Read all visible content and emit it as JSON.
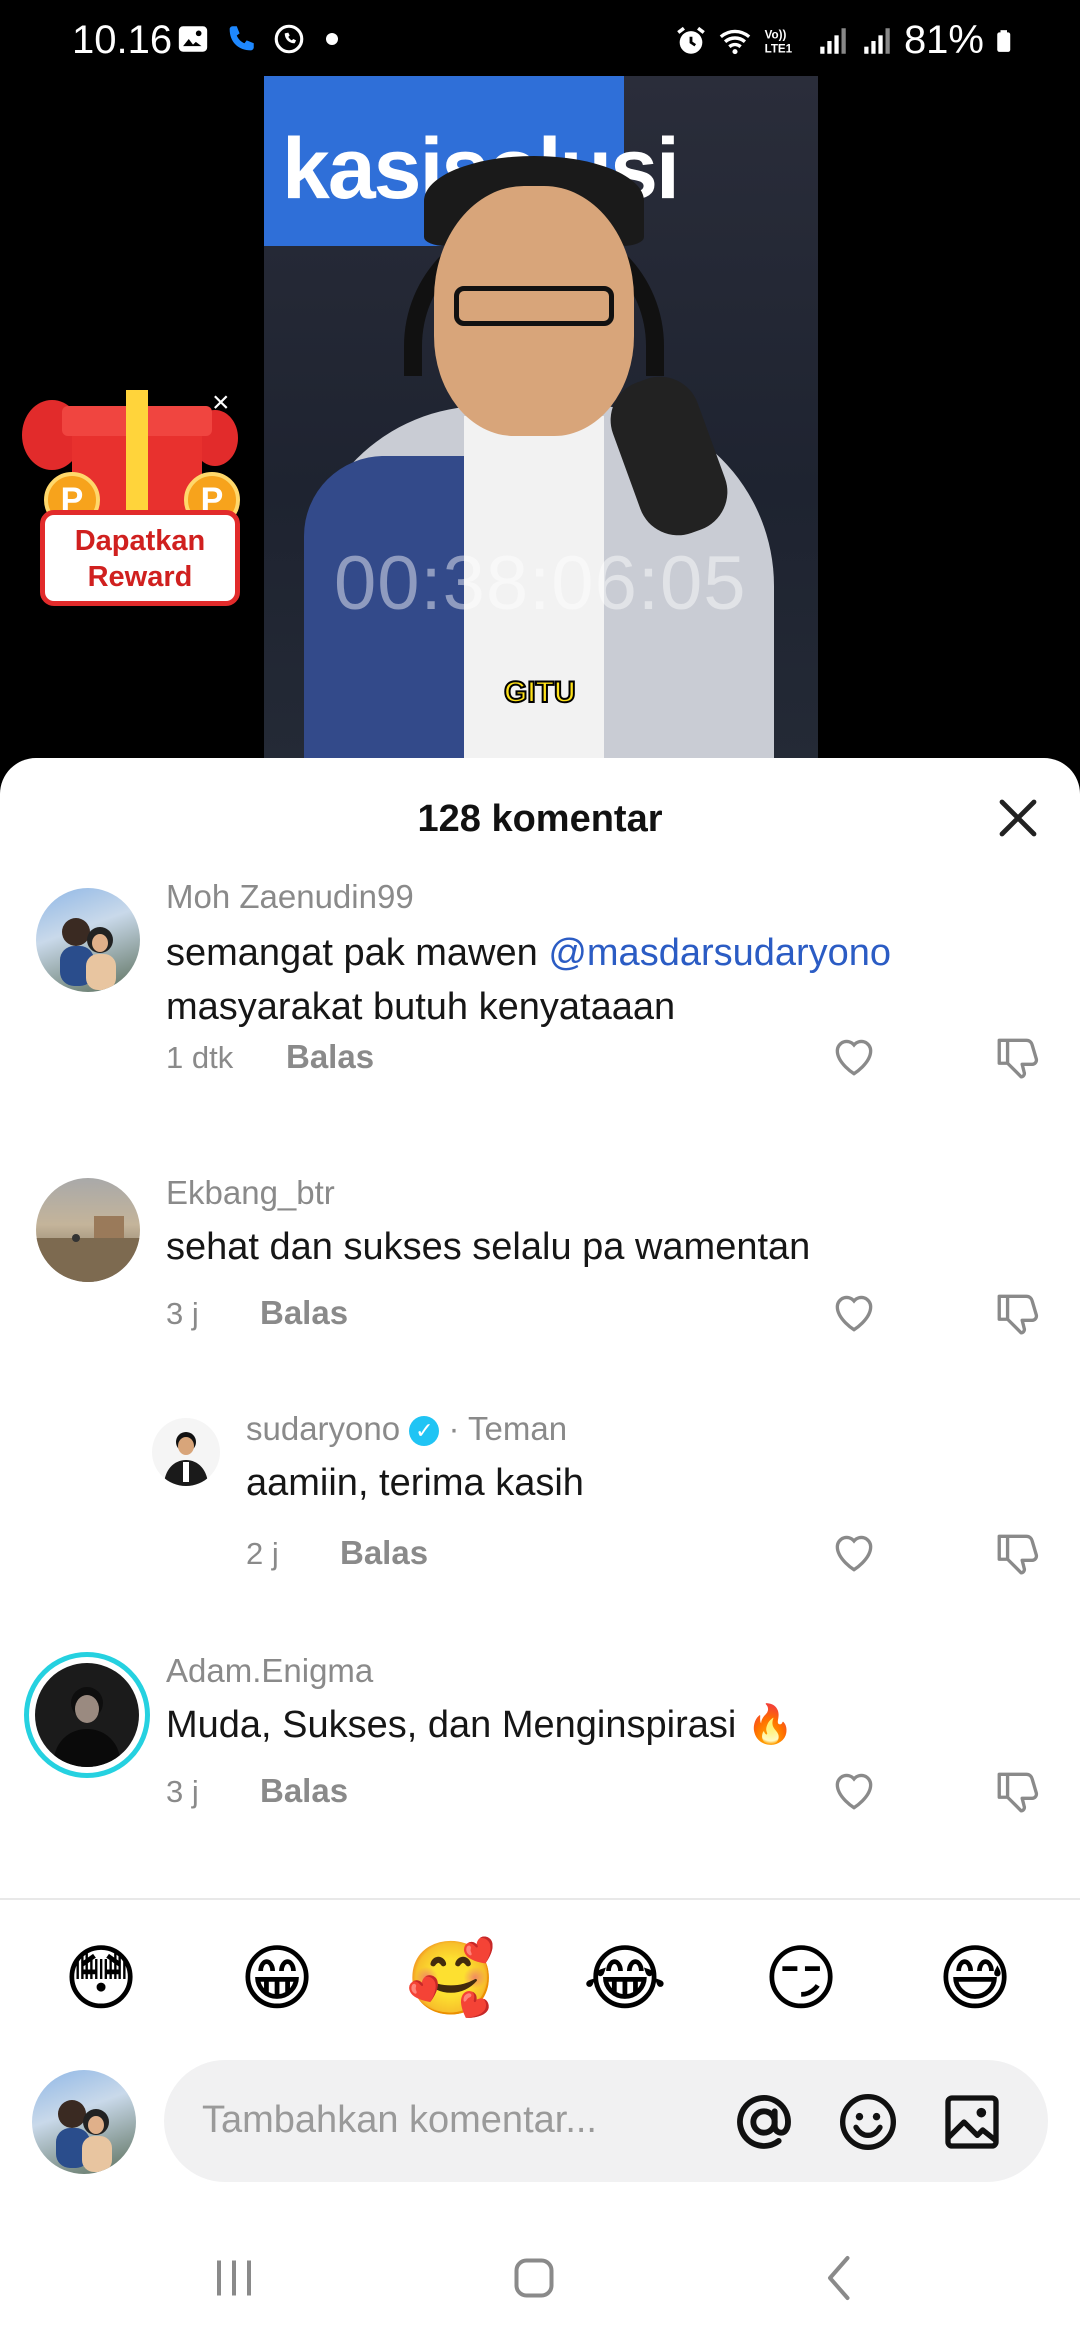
{
  "status_bar": {
    "time": "10.16",
    "battery": "81%",
    "network_label": "Vo)) LTE1"
  },
  "video": {
    "banner_text": "kasisolusi",
    "timecode": "00:38:06:05",
    "caption": "GITU"
  },
  "reward": {
    "label": "Dapatkan Reward",
    "coin_letter": "P",
    "close_glyph": "×"
  },
  "sheet": {
    "title": "128 komentar"
  },
  "comments": [
    {
      "user": "Moh Zaenudin99",
      "text_line1": "semangat pak mawen ",
      "mention": "@masdarsudaryono",
      "text_line2": "masyarakat butuh kenyataaan",
      "time": "1 dtk",
      "reply_label": "Balas"
    },
    {
      "user": "Ekbang_btr",
      "text_line1": "sehat dan sukses selalu pa wamentan",
      "time": "3 j",
      "reply_label": "Balas"
    },
    {
      "user": "sudaryono",
      "friend_tag": "· Teman",
      "text_line1": "aamiin, terima kasih",
      "time": "2 j",
      "reply_label": "Balas"
    },
    {
      "user": "Adam.Enigma",
      "text_line1": "Muda, Sukses, dan Menginspirasi 🔥",
      "time": "3 j",
      "reply_label": "Balas"
    }
  ],
  "emojis": [
    "😳",
    "😁",
    "🥰",
    "😂",
    "😏",
    "😅"
  ],
  "input": {
    "placeholder": "Tambahkan komentar..."
  },
  "icons": {
    "mention": "at-icon",
    "emoji": "smiley-icon",
    "image": "image-icon",
    "like": "heart-icon",
    "dislike": "thumbs-down-icon"
  },
  "colors": {
    "mention": "#2b5cc4",
    "verified": "#20c4f4",
    "story_ring": "#25d1e0"
  }
}
